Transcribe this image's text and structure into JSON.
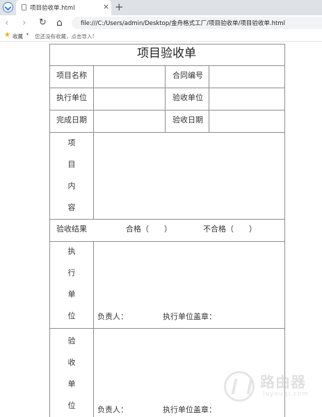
{
  "browser": {
    "tab_title": "项目验收单.html",
    "tab_close": "×",
    "new_tab": "+",
    "address": "file:///C:/Users/admin/Desktop/金舟格式工厂/项目验收单/项目验收单.html",
    "bookmarks_label": "收藏",
    "bookmarks_dropdown": "▾",
    "bookmarks_hint": "您还没有收藏，点击导入!",
    "nav": {
      "back": "‹",
      "forward": "›",
      "reload": "↻",
      "home": "⌂"
    }
  },
  "form": {
    "title": "项目验收单",
    "project_name_label": "项目名称",
    "contract_no_label": "合同编号",
    "executing_unit_label": "执行单位",
    "accepting_unit_label": "验收单位",
    "completion_date_label": "完成日期",
    "acceptance_date_label": "验收日期",
    "content_label_chars": [
      "项",
      "目",
      "内",
      "容"
    ],
    "result_label": "验收结果",
    "pass_option": "合格（　　）",
    "fail_option": "不合格（　　）",
    "exec_block_chars": [
      "执",
      "行",
      "单",
      "位"
    ],
    "exec_responsible": "负责人：",
    "exec_seal": "执行单位盖章：",
    "accept_block_chars": [
      "验",
      "收",
      "单",
      "位"
    ],
    "accept_responsible": "负责人：",
    "accept_seal": "执行单位盖章："
  },
  "watermark": {
    "text": "路由器",
    "sub": "luyouqi.com"
  }
}
